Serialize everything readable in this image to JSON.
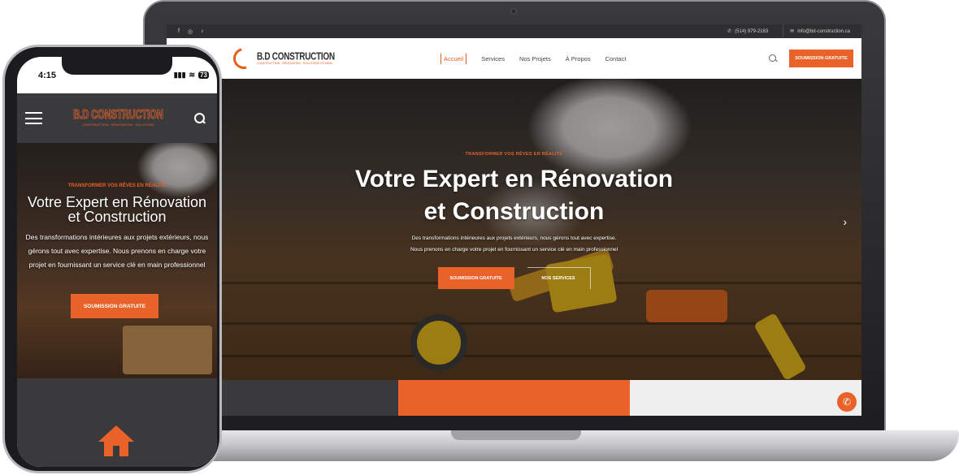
{
  "desktop": {
    "topbar": {
      "social_icons": [
        "facebook-icon",
        "instagram-icon",
        "tiktok-icon"
      ],
      "social_glyphs": [
        "f",
        "◎",
        "♪"
      ],
      "phone": "(514) 979-2163",
      "email": "info@bd-construction.ca"
    },
    "logo": {
      "title": "B.D CONSTRUCTION",
      "tagline": "CONSTRUCTION · RÉNOVATION · SOLUTIONS EN MAIN"
    },
    "nav": {
      "items": [
        "Accueil",
        "Services",
        "Nos Projets",
        "À Propos",
        "Contact"
      ],
      "active": "Accueil",
      "cta": "SOUMISSION GRATUITE"
    },
    "hero": {
      "eyebrow": "TRANSFORMER VOS RÊVES EN RÉALITÉ",
      "title_line1": "Votre Expert en Rénovation",
      "title_line2": "et Construction",
      "desc_line1": "Des transformations intérieures aux projets extérieurs, nous gérons tout avec expertise.",
      "desc_line2": "Nous prenons en charge votre projet en fournissant un service clé en main professionnel",
      "btn_primary": "SOUMISSION GRATUITE",
      "btn_secondary": "NOS SERVICES",
      "next_arrow": "›"
    },
    "phone_fab_icon": "✆"
  },
  "mobile": {
    "status": {
      "time": "4:15",
      "battery": "73",
      "signal": "▮▮▮",
      "wifi": "≋"
    },
    "logo": {
      "title": "B.D CONSTRUCTION",
      "tagline": "CONSTRUCTION · RÉNOVATION · SOLUTIONS"
    },
    "hero": {
      "eyebrow": "TRANSFORMER VOS RÊVES EN RÉALITÉ",
      "title_line1": "Votre Expert en Rénovation",
      "title_line2": "et Construction",
      "desc_line1": "Des transformations intérieures aux projets extérieurs, nous",
      "desc_line2": "gérons tout avec expertise. Nous prenons en charge votre",
      "desc_line3": "projet en fournissant un service clé en main professionnel",
      "btn_primary": "SOUMISSION GRATUITE"
    }
  },
  "colors": {
    "accent": "#e8622a",
    "dark": "#3a3a3c",
    "light": "#efefef"
  }
}
